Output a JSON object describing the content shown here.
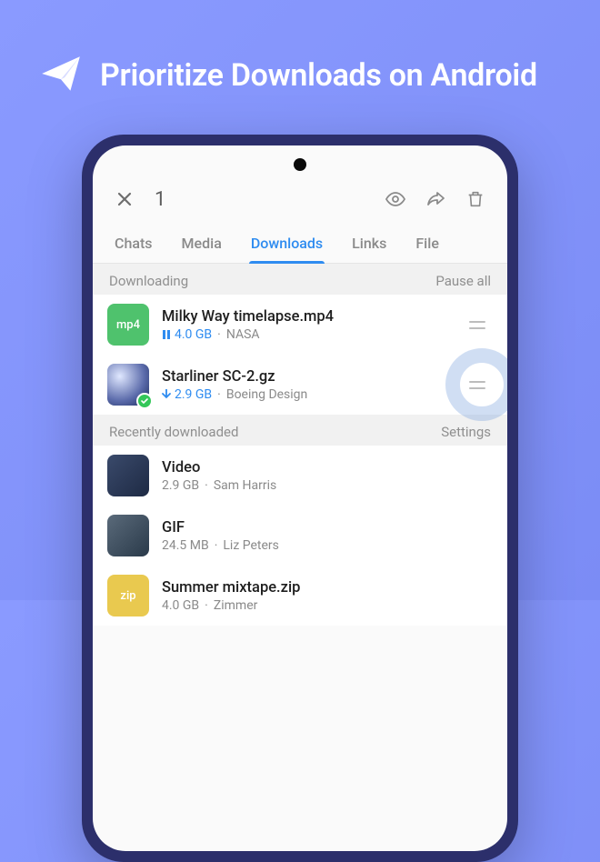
{
  "hero": {
    "title": "Prioritize Downloads on Android"
  },
  "topbar": {
    "selected_count": "1"
  },
  "tabs": [
    {
      "label": "Chats",
      "active": false
    },
    {
      "label": "Media",
      "active": false
    },
    {
      "label": "Downloads",
      "active": true
    },
    {
      "label": "Links",
      "active": false
    },
    {
      "label": "File",
      "active": false
    }
  ],
  "sections": {
    "downloading": {
      "title": "Downloading",
      "action": "Pause all",
      "items": [
        {
          "name": "Milky Way timelapse.mp4",
          "status_icon": "pause",
          "size": "4.0 GB",
          "source": "NASA",
          "thumb_label": "mp4",
          "thumb_kind": "mp4",
          "checked": false
        },
        {
          "name": "Starliner SC-2.gz",
          "status_icon": "down",
          "size": "2.9 GB",
          "source": "Boeing Design",
          "thumb_label": "",
          "thumb_kind": "earth",
          "checked": true,
          "touch": true
        }
      ]
    },
    "recent": {
      "title": "Recently downloaded",
      "action": "Settings",
      "items": [
        {
          "name": "Video",
          "size": "2.9 GB",
          "source": "Sam Harris",
          "thumb_kind": "img"
        },
        {
          "name": "GIF",
          "size": "24.5 MB",
          "source": "Liz Peters",
          "thumb_kind": "img2"
        },
        {
          "name": "Summer mixtape.zip",
          "size": "4.0 GB",
          "source": "Zimmer",
          "thumb_label": "zip",
          "thumb_kind": "zip"
        }
      ]
    }
  }
}
